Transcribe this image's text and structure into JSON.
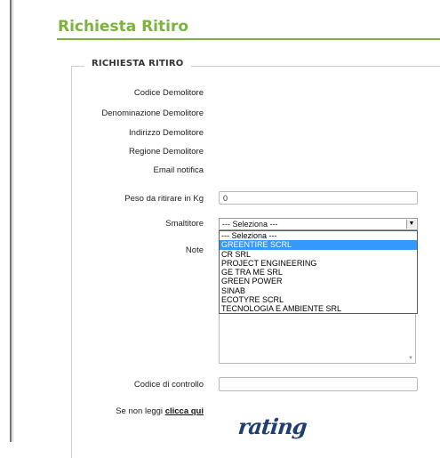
{
  "page_title": "Richiesta Ritiro",
  "section_legend": "RICHIESTA RITIRO",
  "fields": {
    "codice_demolitore": "Codice Demolitore",
    "denominazione": "Denominazione Demolitore",
    "indirizzo": "Indirizzo Demolitore",
    "regione": "Regione Demolitore",
    "email": "Email notifica",
    "peso_label": "Peso da ritirare in Kg",
    "peso_value": "0",
    "smaltitore_label": "Smaltitore",
    "note_label": "Note",
    "codice_controllo_label": "Codice di controllo"
  },
  "smaltitore": {
    "selected": "--- Seleziona ---",
    "options": [
      "--- Seleziona ---",
      "GREENTIRE SCRL",
      "CR SRL",
      "PROJECT ENGINEERING",
      "GE TRA ME SRL",
      "GREEN POWER",
      "SINAB",
      "ECOTYRE SCRL",
      "TECNOLOGIA E AMBIENTE SRL"
    ],
    "highlighted_index": 1
  },
  "captcha": {
    "prompt": "Se non leggi",
    "link": "clicca qui",
    "text": "rating"
  },
  "colors": {
    "accent_green": "#7cb33a",
    "highlight_blue": "#3399ff"
  }
}
